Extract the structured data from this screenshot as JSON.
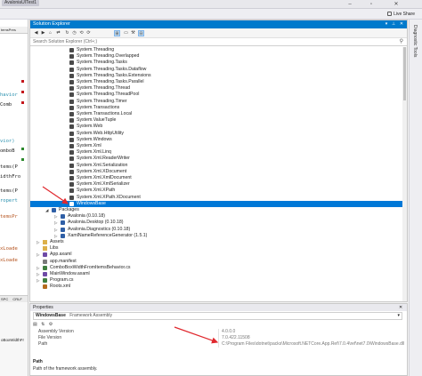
{
  "window": {
    "title": "AvaloniaUITest1",
    "live_share": "Live Share"
  },
  "editor": {
    "tab_label": "temsPres",
    "code_fragments": [
      "havior",
      "Comb",
      "vior)",
      "omboB",
      "tems(P",
      "idthFro",
      "tems(P",
      "ropert",
      "temsPr",
      "xLoade",
      "xLoade"
    ],
    "status_items": [
      "SPC",
      "CRLF"
    ],
    "lower_label": "oBoxWidthFr"
  },
  "solution_explorer": {
    "title": "Solution Explorer",
    "search_placeholder": "Search Solution Explorer (Ctrl+;)",
    "items": [
      {
        "label": "System.Threading",
        "depth": 4,
        "icon": "assembly"
      },
      {
        "label": "System.Threading.Overlapped",
        "depth": 4,
        "icon": "assembly"
      },
      {
        "label": "System.Threading.Tasks",
        "depth": 4,
        "icon": "assembly"
      },
      {
        "label": "System.Threading.Tasks.Dataflow",
        "depth": 4,
        "icon": "assembly"
      },
      {
        "label": "System.Threading.Tasks.Extensions",
        "depth": 4,
        "icon": "assembly"
      },
      {
        "label": "System.Threading.Tasks.Parallel",
        "depth": 4,
        "icon": "assembly"
      },
      {
        "label": "System.Threading.Thread",
        "depth": 4,
        "icon": "assembly"
      },
      {
        "label": "System.Threading.ThreadPool",
        "depth": 4,
        "icon": "assembly"
      },
      {
        "label": "System.Threading.Timer",
        "depth": 4,
        "icon": "assembly"
      },
      {
        "label": "System.Transactions",
        "depth": 4,
        "icon": "assembly"
      },
      {
        "label": "System.Transactions.Local",
        "depth": 4,
        "icon": "assembly"
      },
      {
        "label": "System.ValueTuple",
        "depth": 4,
        "icon": "assembly"
      },
      {
        "label": "System.Web",
        "depth": 4,
        "icon": "assembly"
      },
      {
        "label": "System.Web.HttpUtility",
        "depth": 4,
        "icon": "assembly"
      },
      {
        "label": "System.Windows",
        "depth": 4,
        "icon": "assembly"
      },
      {
        "label": "System.Xml",
        "depth": 4,
        "icon": "assembly"
      },
      {
        "label": "System.Xml.Linq",
        "depth": 4,
        "icon": "assembly"
      },
      {
        "label": "System.Xml.ReaderWriter",
        "depth": 4,
        "icon": "assembly"
      },
      {
        "label": "System.Xml.Serialization",
        "depth": 4,
        "icon": "assembly"
      },
      {
        "label": "System.Xml.XDocument",
        "depth": 4,
        "icon": "assembly"
      },
      {
        "label": "System.Xml.XmlDocument",
        "depth": 4,
        "icon": "assembly"
      },
      {
        "label": "System.Xml.XmlSerializer",
        "depth": 4,
        "icon": "assembly"
      },
      {
        "label": "System.Xml.XPath",
        "depth": 4,
        "icon": "assembly"
      },
      {
        "label": "System.Xml.XPath.XDocument",
        "depth": 4,
        "icon": "assembly"
      },
      {
        "label": "WindowsBase",
        "depth": 4,
        "icon": "assembly",
        "selected": true
      },
      {
        "label": "Packages",
        "depth": 2,
        "icon": "package",
        "expander": "open"
      },
      {
        "label": "Avalonia (0.10.18)",
        "depth": 3,
        "icon": "package",
        "expander": "closed"
      },
      {
        "label": "Avalonia.Desktop (0.10.18)",
        "depth": 3,
        "icon": "package",
        "expander": "closed"
      },
      {
        "label": "Avalonia.Diagnostics (0.10.18)",
        "depth": 3,
        "icon": "package",
        "expander": "closed"
      },
      {
        "label": "XamlNameReferenceGenerator (1.5.1)",
        "depth": 3,
        "icon": "package",
        "expander": "closed"
      },
      {
        "label": "Assets",
        "depth": 1,
        "icon": "folder",
        "expander": "closed"
      },
      {
        "label": "Libs",
        "depth": 1,
        "icon": "folder",
        "expander": "none"
      },
      {
        "label": "App.axaml",
        "depth": 1,
        "icon": "xaml",
        "expander": "closed"
      },
      {
        "label": "app.manifest",
        "depth": 1,
        "icon": "file",
        "expander": "none"
      },
      {
        "label": "ComboBoxWidthFromItemsBehavior.cs",
        "depth": 1,
        "icon": "csharp",
        "expander": "closed"
      },
      {
        "label": "MainWindow.axaml",
        "depth": 1,
        "icon": "xaml",
        "expander": "closed"
      },
      {
        "label": "Program.cs",
        "depth": 1,
        "icon": "csharp",
        "expander": "closed"
      },
      {
        "label": "Roots.xml",
        "depth": 1,
        "icon": "xml",
        "expander": "none"
      }
    ]
  },
  "right_panel": {
    "tab_label": "Diagnostic Tools"
  },
  "properties": {
    "title": "Properties",
    "object_name": "WindowsBase",
    "object_type": "Framework Assembly",
    "rows": [
      {
        "name": "Assembly Version",
        "value": "4.0.0.0"
      },
      {
        "name": "File Version",
        "value": "7.0.422.11508"
      },
      {
        "name": "Path",
        "value": "C:\\Program Files\\dotnet\\packs\\Microsoft.NETCore.App.Ref\\7.0.4\\ref\\net7.0\\WindowsBase.dll"
      }
    ],
    "description_title": "Path",
    "description_text": "Path of the framework assembly."
  },
  "colors": {
    "accent": "#007acc",
    "selection": "#0078d7",
    "annotation_arrow": "#e0282e"
  }
}
